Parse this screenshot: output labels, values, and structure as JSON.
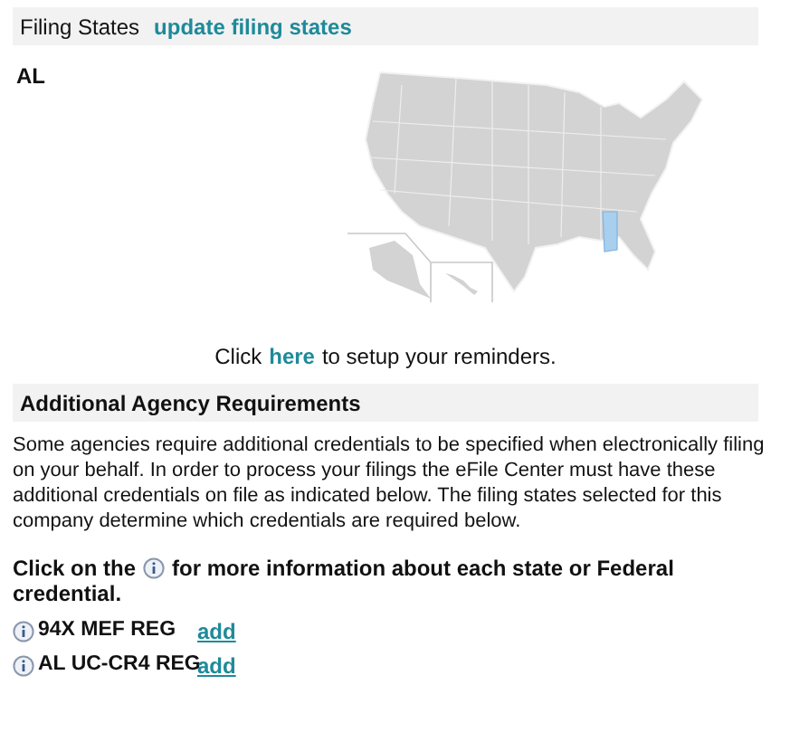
{
  "filing_states": {
    "title": "Filing States",
    "update_link": "update filing states",
    "states": [
      "AL"
    ]
  },
  "reminder": {
    "before": "Click",
    "link": "here",
    "after": "to setup your reminders."
  },
  "agency_requirements": {
    "title": "Additional Agency Requirements",
    "description": "Some agencies require additional credentials to be specified when electronically filing on your behalf. In order to process your filings the eFile Center must have these additional credentials on file as indicated below. The filing states selected for this company determine which credentials are required below.",
    "instruction_before": "Click on the",
    "instruction_after": "for more information about each state or Federal",
    "instruction_end": "credential.",
    "credentials": [
      {
        "name": "94X MEF REG",
        "action": "add"
      },
      {
        "name": "AL UC-CR4 REG",
        "action": "add"
      }
    ]
  }
}
